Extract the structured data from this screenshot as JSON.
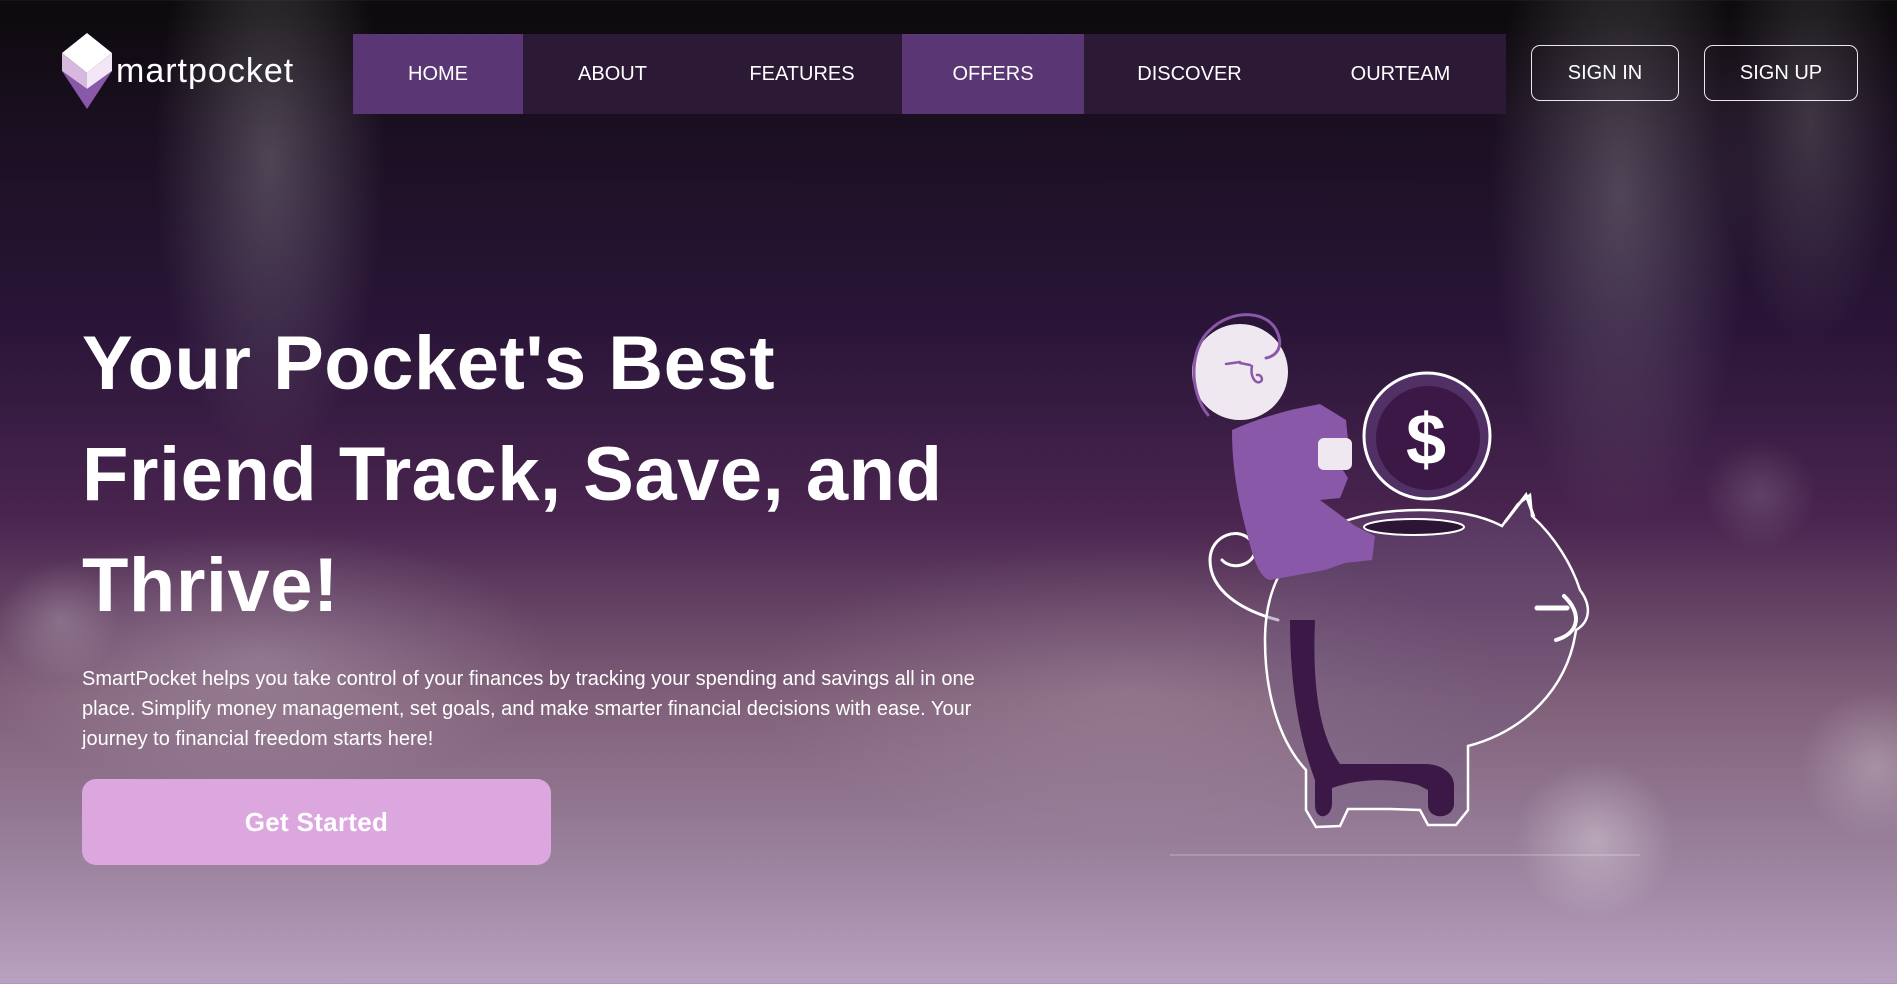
{
  "brand": {
    "name": "martpocket",
    "logo_icon": "cube-logo-icon"
  },
  "nav": {
    "items": [
      {
        "label": "HOME",
        "active": true
      },
      {
        "label": "ABOUT",
        "active": false
      },
      {
        "label": "FEATURES",
        "active": false
      },
      {
        "label": "OFFERS",
        "active": true
      },
      {
        "label": "DISCOVER",
        "active": false
      },
      {
        "label": "OURTEAM",
        "active": false
      }
    ]
  },
  "auth": {
    "sign_in_label": "SIGN IN",
    "sign_up_label": "SIGN UP"
  },
  "hero": {
    "title_line_1": "Your Pocket's Best",
    "title_line_2": "Friend Track, Save, and",
    "title_line_3": "Thrive!",
    "description": "SmartPocket helps you take control of your finances by tracking your spending and savings all in one place. Simplify money management, set goals, and make smarter financial decisions with ease. Your journey to financial freedom starts here!",
    "cta_label": "Get Started"
  },
  "illustration": {
    "coin_symbol": "$",
    "icon": "piggy-bank-illustration"
  },
  "colors": {
    "nav_background": "#2c1936",
    "nav_active": "#5a3674",
    "cta_background": "#dba7de",
    "accent_purple": "#8a58a8"
  }
}
